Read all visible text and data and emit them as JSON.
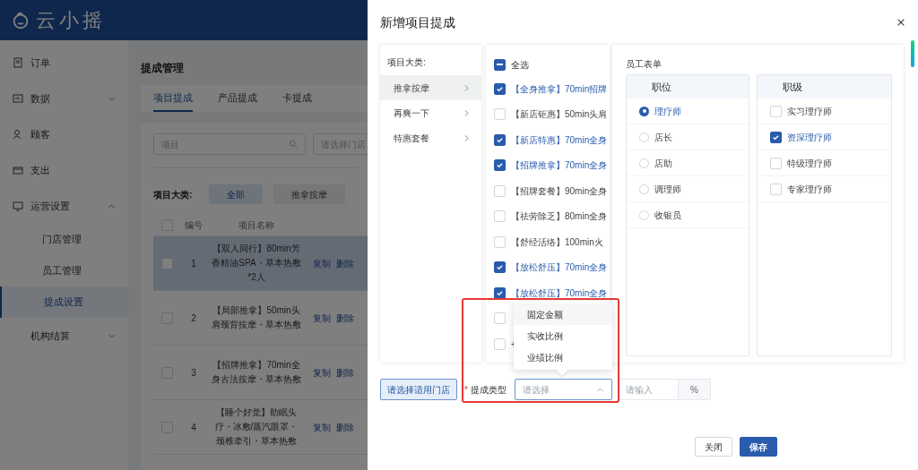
{
  "app": {
    "logo": "云小摇"
  },
  "sidebar": [
    {
      "label": "订单",
      "selected": false
    },
    {
      "label": "数据",
      "selected": false,
      "expanded": false
    },
    {
      "label": "顾客",
      "selected": false
    },
    {
      "label": "支出",
      "selected": false
    },
    {
      "label": "运营设置",
      "selected": false,
      "expanded": true,
      "children": [
        {
          "label": "门店管理",
          "selected": false
        },
        {
          "label": "员工管理",
          "selected": false
        },
        {
          "label": "提成设置",
          "selected": true
        }
      ]
    },
    {
      "label": "机构结算",
      "selected": false,
      "expanded": false
    }
  ],
  "page": {
    "title": "提成管理",
    "tabs": [
      {
        "label": "项目提成",
        "selected": true
      },
      {
        "label": "产品提成",
        "selected": false
      },
      {
        "label": "卡提成",
        "selected": false
      }
    ],
    "search": {
      "placeholder": "项目"
    },
    "store_select": {
      "placeholder": "请选择门店"
    },
    "filter": {
      "label": "项目大类:",
      "options": [
        {
          "label": "全部",
          "selected": true
        },
        {
          "label": "推拿按摩",
          "selected": false
        }
      ]
    },
    "table": {
      "header_checked": false,
      "columns": [
        "编号",
        "项目名称"
      ],
      "rows": [
        {
          "number": "1",
          "name": "【双人同行】80min芳香精油SPA・草本热敷*2人",
          "selected": true,
          "actions": [
            "复制",
            "删除"
          ]
        },
        {
          "number": "2",
          "name": "【局部推拿】50min头肩颈背按摩・草本热敷",
          "selected": false,
          "actions": [
            "复制",
            "删除"
          ]
        },
        {
          "number": "3",
          "name": "【招牌推拿】70min全身古法按摩・草本热敷",
          "selected": false,
          "actions": [
            "复制",
            "删除"
          ]
        },
        {
          "number": "4",
          "name": "【睡个好觉】助眠头疗・冰敷/蒸汽眼罩・颈椎牵引・草本热敷",
          "selected": false,
          "actions": [
            "复制",
            "删除"
          ]
        }
      ]
    }
  },
  "modal": {
    "title": "新增项目提成",
    "categories": {
      "heading": "项目大类:",
      "items": [
        {
          "label": "推拿按摩",
          "selected": true
        },
        {
          "label": "再爽一下",
          "selected": false
        },
        {
          "label": "特惠套餐",
          "selected": false
        }
      ]
    },
    "projects": {
      "select_all": {
        "label": "全选",
        "indeterminate": true
      },
      "items": [
        {
          "label": "【全身推拿】70min招牌",
          "checked": true
        },
        {
          "label": "【新店钜惠】50min头肩",
          "checked": false
        },
        {
          "label": "【新店特惠】70min全身",
          "checked": true
        },
        {
          "label": "【招牌推拿】70min全身",
          "checked": true
        },
        {
          "label": "【招牌套餐】90min全身",
          "checked": false
        },
        {
          "label": "【祛劳除乏】80min全身",
          "checked": false
        },
        {
          "label": "【舒经活络】100min火",
          "checked": false
        },
        {
          "label": "【放松舒压】70min全身",
          "checked": true
        },
        {
          "label": "【放松舒压】70min全身",
          "checked": true
        },
        {
          "checked": false
        },
        {
          "label": "+",
          "checked": false
        }
      ]
    },
    "staff": {
      "heading": "员工表单",
      "positions": {
        "heading": "职位",
        "items": [
          {
            "label": "理疗师",
            "selected": true
          },
          {
            "label": "店长",
            "selected": false
          },
          {
            "label": "店助",
            "selected": false
          },
          {
            "label": "调理师",
            "selected": false
          },
          {
            "label": "收银员",
            "selected": false
          }
        ]
      },
      "levels": {
        "heading": "职级",
        "items": [
          {
            "label": "实习理疗师",
            "checked": false
          },
          {
            "label": "资深理疗师",
            "checked": true
          },
          {
            "label": "特级理疗师",
            "checked": false
          },
          {
            "label": "专家理疗师",
            "checked": false
          }
        ]
      }
    },
    "store_button": "请选择适用门店",
    "type_field": {
      "label": "提成类型",
      "required_mark": "*",
      "placeholder": "请选择",
      "expanded": true,
      "options": [
        {
          "label": "固定金额",
          "highlighted": true
        },
        {
          "label": "实收比例",
          "highlighted": false
        },
        {
          "label": "业绩比例",
          "highlighted": false
        }
      ]
    },
    "amount": {
      "placeholder": "请输入",
      "unit": "%"
    },
    "buttons": [
      {
        "label": "关闭",
        "kind": "default"
      },
      {
        "label": "保存",
        "kind": "primary"
      }
    ]
  }
}
